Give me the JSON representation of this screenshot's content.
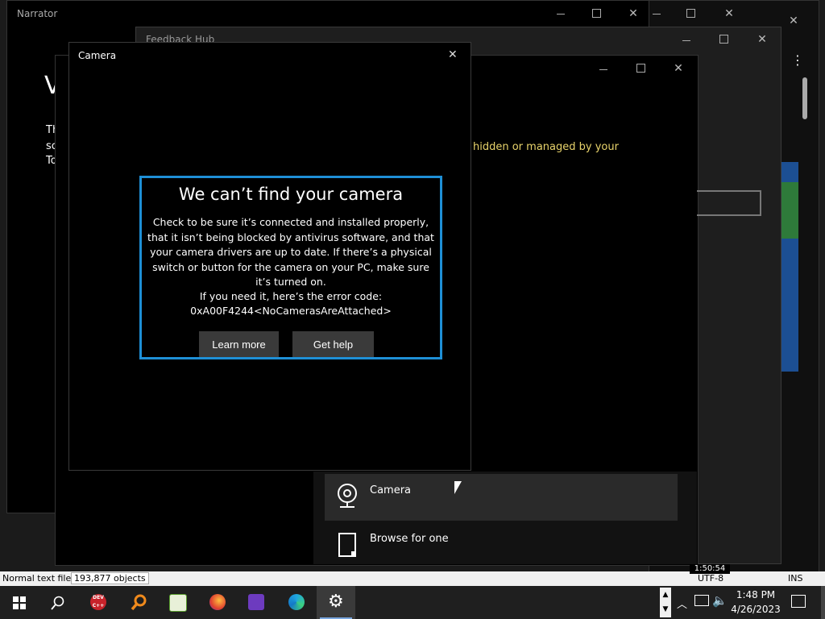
{
  "narrator": {
    "title": "Narrator",
    "fragment_big": "V",
    "frag1": "Th",
    "frag2": "sc",
    "frag3": "To"
  },
  "feedback_hub": {
    "title": "Feedback Hub"
  },
  "background_window": {
    "warning_text": "hidden or managed by your"
  },
  "picker": {
    "items": [
      {
        "label": "Camera",
        "icon": "webcam-icon"
      },
      {
        "label": "Browse for one",
        "icon": "file-icon"
      }
    ]
  },
  "camera_window": {
    "title": "Camera",
    "dialog": {
      "heading": "We can’t find your camera",
      "body": "Check to be sure it’s connected and installed properly, that it isn’t being blocked by antivirus software, and that your camera drivers are up to date. If there’s a physical switch or button for the camera on your PC, make sure it’s turned on.",
      "error_intro": "If you need it, here’s the error code:",
      "error_code": "0xA00F4244<NoCamerasAreAttached>",
      "learn_more": "Learn more",
      "get_help": "Get help"
    }
  },
  "statusbar": {
    "file_type": "Normal text file",
    "objects": "193,877 objects",
    "encoding": "UTF-8",
    "mode": "INS",
    "time_overlay": "1:50:54"
  },
  "taskbar": {
    "time": "1:48 PM",
    "date": "4/26/2023",
    "apps": [
      "Start",
      "Search",
      "Dev-C++",
      "Search Everything",
      "Notepad++",
      "Firefox",
      "Visual Studio",
      "Edge",
      "Settings"
    ],
    "devcpp_label": "DEV C++"
  },
  "colors": {
    "dialog_border": "#1e8fd6",
    "warning": "#e8d36b",
    "taskbar": "#1f1f1f"
  }
}
